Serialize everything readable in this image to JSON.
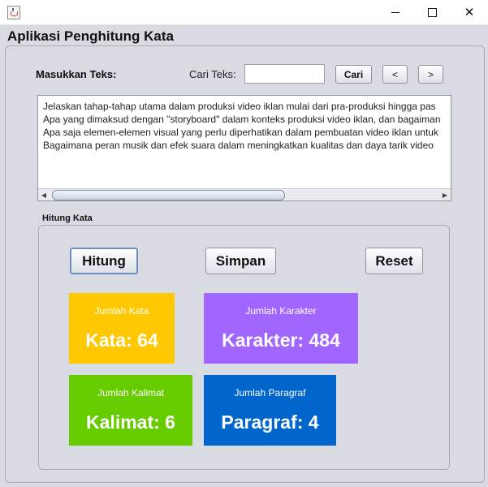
{
  "window": {
    "app_title": "Aplikasi Penghitung Kata",
    "icon": "java-icon"
  },
  "input": {
    "label": "Masukkan Teks:",
    "search_label": "Cari Teks:",
    "search_value": "",
    "search_button": "Cari",
    "prev_button": "<",
    "next_button": ">",
    "lines": [
      "Jelaskan tahap-tahap utama dalam produksi video iklan mulai dari pra-produksi hingga pas",
      "Apa yang dimaksud dengan \"storyboard\" dalam konteks produksi video iklan, dan bagaiman",
      "Apa saja elemen-elemen visual yang perlu diperhatikan dalam pembuatan video iklan untuk",
      "Bagaimana peran musik dan efek suara dalam meningkatkan kualitas dan daya tarik video"
    ]
  },
  "counter": {
    "group_label": "Hitung Kata",
    "buttons": {
      "hitung": "Hitung",
      "simpan": "Simpan",
      "reset": "Reset"
    },
    "cards": {
      "kata": {
        "caption": "Jumlah Kata",
        "value_text": "Kata: 64",
        "color": "#ffc800"
      },
      "karakter": {
        "caption": "Jumlah Karakter",
        "value_text": "Karakter: 484",
        "color": "#a066ff"
      },
      "kalimat": {
        "caption": "Jumlah Kalimat",
        "value_text": "Kalimat: 6",
        "color": "#66cc00"
      },
      "paragraf": {
        "caption": "Jumlah Paragraf",
        "value_text": "Paragraf: 4",
        "color": "#0066cc"
      }
    }
  }
}
